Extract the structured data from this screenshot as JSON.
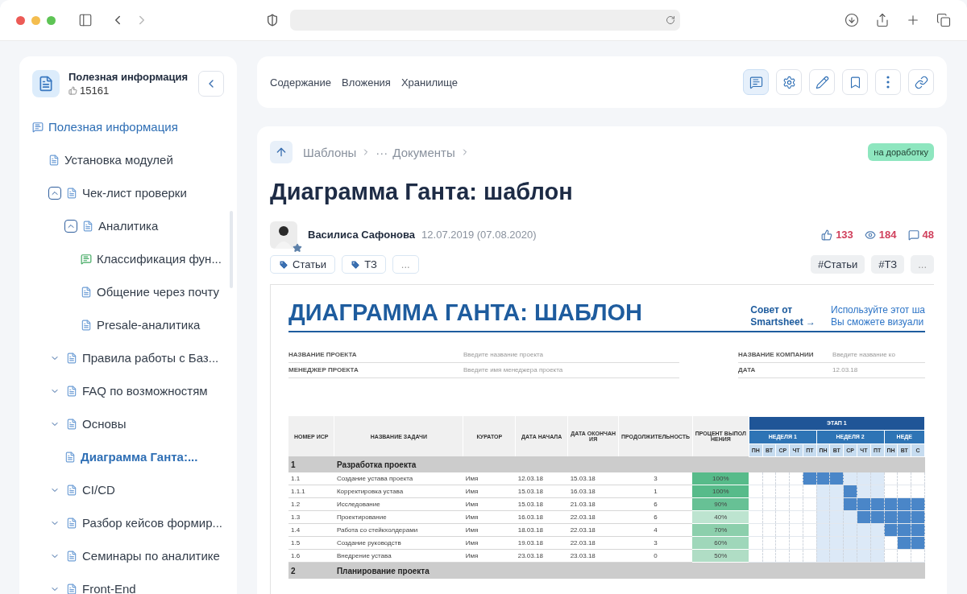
{
  "sidebar": {
    "title": "Полезная информация",
    "likes": "15161",
    "tree": [
      {
        "label": "Полезная информация",
        "kind": "thread",
        "selected": false,
        "children": [
          {
            "label": "Установка модулей",
            "kind": "page",
            "selected": false
          },
          {
            "label": "Чек-лист проверки",
            "kind": "page",
            "selected": false,
            "expanded": true,
            "children": [
              {
                "label": "Аналитика",
                "kind": "page",
                "selected": false,
                "expanded": true,
                "children": [
                  {
                    "label": "Классификация фун...",
                    "kind": "note",
                    "selected": false
                  },
                  {
                    "label": "Общение через почту",
                    "kind": "page",
                    "selected": false
                  },
                  {
                    "label": "Presale-аналитика",
                    "kind": "page",
                    "selected": false
                  }
                ]
              }
            ]
          },
          {
            "label": "Правила работы с Баз...",
            "kind": "page",
            "selected": false,
            "expanded": false
          },
          {
            "label": "FAQ по возможностям",
            "kind": "page",
            "selected": false,
            "expanded": false
          },
          {
            "label": "Основы",
            "kind": "page",
            "selected": false,
            "expanded": false,
            "children": [
              {
                "label": "Диаграмма Ганта:...",
                "kind": "page",
                "selected": true
              }
            ]
          },
          {
            "label": "CI/CD",
            "kind": "page",
            "selected": false,
            "expanded": false
          },
          {
            "label": "Разбор кейсов формир...",
            "kind": "page",
            "selected": false,
            "expanded": false
          },
          {
            "label": "Семинары по аналитике",
            "kind": "page",
            "selected": false,
            "expanded": false
          },
          {
            "label": "Front-End",
            "kind": "page",
            "selected": false,
            "expanded": false
          }
        ]
      }
    ]
  },
  "nav_links": [
    "Содержание",
    "Вложения",
    "Хранилище"
  ],
  "toolbar": [
    {
      "kind": "comments",
      "active": true
    },
    {
      "kind": "settings",
      "active": false
    },
    {
      "kind": "edit",
      "active": false
    },
    {
      "kind": "bookmark",
      "active": false
    },
    {
      "kind": "more",
      "active": false
    },
    {
      "kind": "link",
      "active": false
    }
  ],
  "article": {
    "breadcrumbs": [
      "Шаблоны",
      "···",
      "Документы"
    ],
    "status": "на доработку",
    "title": "Диаграмма Ганта: шаблон",
    "author": "Василиса Сафонова",
    "date": "12.07.2019 (07.08.2020)",
    "stats": [
      {
        "kind": "likes",
        "value": "133"
      },
      {
        "kind": "views",
        "value": "184"
      },
      {
        "kind": "comments",
        "value": "48"
      }
    ],
    "tags": [
      "Статьи",
      "ТЗ"
    ],
    "tags_more": "...",
    "hashtags": [
      "#Статьи",
      "#ТЗ"
    ],
    "hashtags_more": "...",
    "doc": {
      "title": "ДИАГРАММА ГАНТА: ШАБЛОН",
      "tip_link": "Совет от Smartsheet →",
      "tip_text": [
        "Используйте этот ша",
        "Вы сможете визуали"
      ],
      "fields_left": [
        {
          "label": "НАЗВАНИЕ ПРОЕКТА",
          "value": "Введите название проекта"
        },
        {
          "label": "МЕНЕДЖЕР ПРОЕКТА",
          "value": "Введите имя менеджера проекта"
        }
      ],
      "fields_right": [
        {
          "label": "НАЗВАНИЕ КОМПАНИИ",
          "value": "Введите название ко"
        },
        {
          "label": "ДАТА",
          "value": "12.03.18"
        }
      ],
      "table": {
        "columns": [
          "НОМЕР ИСР",
          "НАЗВАНИЕ ЗАДАЧИ",
          "КУРАТОР",
          "ДАТА НАЧАЛА",
          "ДАТА ОКОНЧАНИЯ",
          "ПРОДОЛЖИТЕЛЬНОСТЬ",
          "ПРОЦЕНТ ВЫПОЛНЕНИЯ"
        ],
        "gantt": {
          "phase": "ЭТАП 1",
          "weeks": [
            {
              "label": "НЕДЕЛЯ 1",
              "highlighted": false,
              "days": [
                "ПН",
                "ВТ",
                "СР",
                "ЧТ",
                "ПТ"
              ]
            },
            {
              "label": "НЕДЕЛЯ 2",
              "highlighted": true,
              "days": [
                "ПН",
                "ВТ",
                "СР",
                "ЧТ",
                "ПТ"
              ]
            },
            {
              "label": "НЕДЕ",
              "highlighted": false,
              "days": [
                "ПН",
                "ВТ",
                "С"
              ]
            }
          ]
        },
        "rows": [
          {
            "kind": "section",
            "cells": [
              "1",
              "Разработка проекта"
            ]
          },
          {
            "kind": "task",
            "cells": [
              "1.1",
              "Создание устава проекта",
              "Имя",
              "12.03.18",
              "15.03.18",
              "3",
              "100%"
            ],
            "color": "#57bb8a",
            "days": [
              false,
              false,
              false,
              false,
              true,
              true,
              true,
              false,
              false,
              false,
              false,
              false,
              false
            ]
          },
          {
            "kind": "task",
            "cells": [
              "1.1.1",
              "Корректировка устава",
              "Имя",
              "15.03.18",
              "16.03.18",
              "1",
              "100%"
            ],
            "color": "#57bb8a",
            "days": [
              false,
              false,
              false,
              false,
              false,
              false,
              false,
              true,
              false,
              false,
              false,
              false,
              false
            ]
          },
          {
            "kind": "task",
            "cells": [
              "1.2",
              "Исследование",
              "Имя",
              "15.03.18",
              "21.03.18",
              "6",
              "90%"
            ],
            "color": "#67c195",
            "days": [
              false,
              false,
              false,
              false,
              false,
              false,
              false,
              true,
              true,
              true,
              true,
              true,
              true
            ]
          },
          {
            "kind": "task",
            "cells": [
              "1.3",
              "Проектирование",
              "Имя",
              "16.03.18",
              "22.03.18",
              "6",
              "40%"
            ],
            "color": "#bde4d0",
            "days": [
              false,
              false,
              false,
              false,
              false,
              false,
              false,
              false,
              true,
              true,
              true,
              true,
              true
            ]
          },
          {
            "kind": "task",
            "cells": [
              "1.4",
              "Работа со стейкхолдерами",
              "Имя",
              "18.03.18",
              "22.03.18",
              "4",
              "70%"
            ],
            "color": "#8ccfac",
            "days": [
              false,
              false,
              false,
              false,
              false,
              false,
              false,
              false,
              false,
              false,
              true,
              true,
              true
            ]
          },
          {
            "kind": "task",
            "cells": [
              "1.5",
              "Создание руководств",
              "Имя",
              "19.03.18",
              "22.03.18",
              "3",
              "60%"
            ],
            "color": "#9fd7ba",
            "days": [
              false,
              false,
              false,
              false,
              false,
              false,
              false,
              false,
              false,
              false,
              false,
              true,
              true
            ]
          },
          {
            "kind": "task",
            "cells": [
              "1.6",
              "Внедрение устава",
              "Имя",
              "23.03.18",
              "23.03.18",
              "0",
              "50%"
            ],
            "color": "#b0ddc5",
            "days": [
              false,
              false,
              false,
              false,
              false,
              false,
              false,
              false,
              false,
              false,
              false,
              false,
              false
            ]
          },
          {
            "kind": "section",
            "cells": [
              "2",
              "Планирование проекта"
            ]
          }
        ]
      }
    }
  }
}
